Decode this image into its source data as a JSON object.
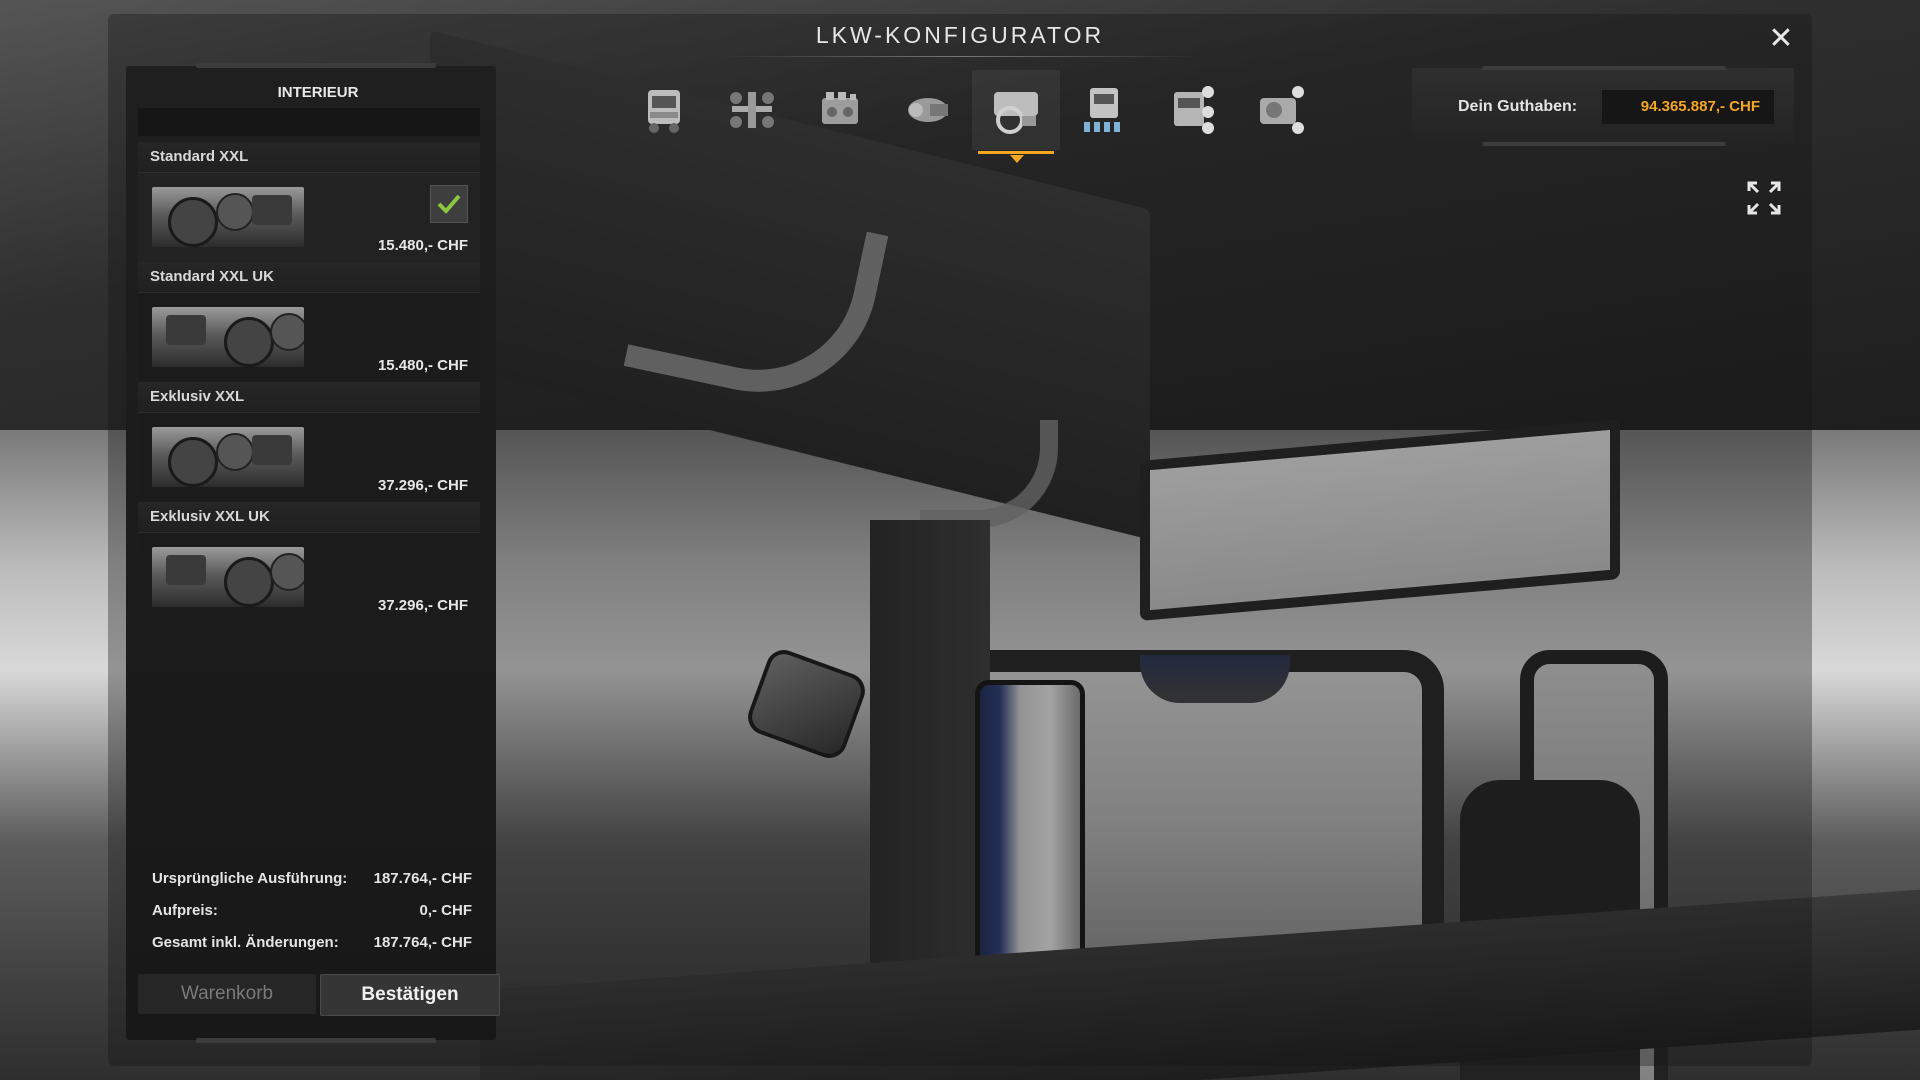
{
  "window": {
    "title": "LKW-KONFIGURATOR"
  },
  "categories": [
    {
      "name": "truck-icon",
      "active": false
    },
    {
      "name": "chassis-icon",
      "active": false
    },
    {
      "name": "engine-icon",
      "active": false
    },
    {
      "name": "transmission-icon",
      "active": false
    },
    {
      "name": "interior-icon",
      "active": true
    },
    {
      "name": "cabin-icon",
      "active": false
    },
    {
      "name": "accessories-icon",
      "active": false
    },
    {
      "name": "paint-icon",
      "active": false
    }
  ],
  "balance": {
    "label": "Dein Guthaben:",
    "value": "94.365.887,- CHF",
    "value_color": "#f5a623"
  },
  "panel": {
    "title": "INTERIEUR",
    "options": [
      {
        "name": "Standard XXL",
        "price": "15.480,- CHF",
        "selected": true
      },
      {
        "name": "Standard XXL UK",
        "price": "15.480,- CHF",
        "selected": false
      },
      {
        "name": "Exklusiv XXL",
        "price": "37.296,- CHF",
        "selected": false
      },
      {
        "name": "Exklusiv XXL UK",
        "price": "37.296,- CHF",
        "selected": false
      }
    ]
  },
  "summary": {
    "original_label": "Ursprüngliche Ausführung:",
    "original_value": "187.764,- CHF",
    "surcharge_label": "Aufpreis:",
    "surcharge_value": "0,- CHF",
    "total_label": "Gesamt inkl. Änderungen:",
    "total_value": "187.764,- CHF"
  },
  "buttons": {
    "cart": "Warenkorb",
    "confirm": "Bestätigen"
  },
  "colors": {
    "accent": "#f5a623",
    "check": "#8dc63f"
  }
}
